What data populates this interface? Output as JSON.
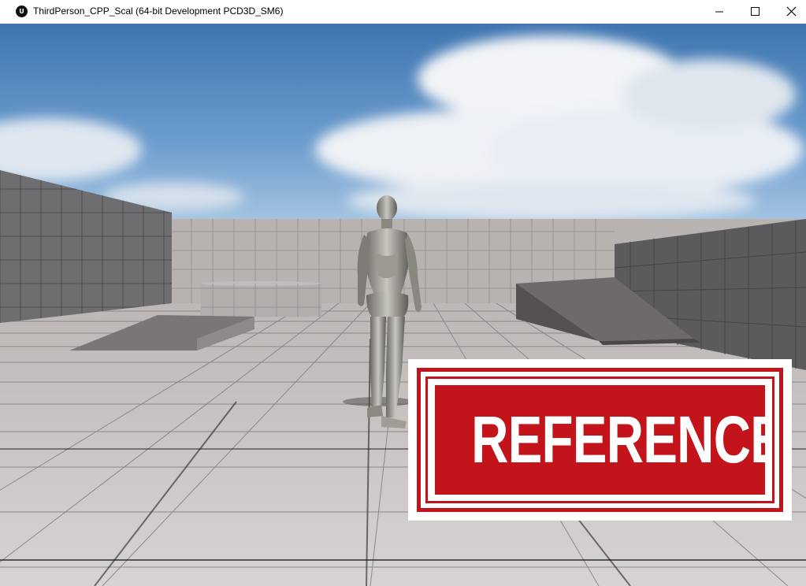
{
  "window": {
    "title": "ThirdPerson_CPP_Scal (64-bit Development PCD3D_SM6)",
    "app_icon": "unreal-engine-logo-icon",
    "app_icon_glyph": "U",
    "controls": [
      "minimize-icon",
      "maximize-icon",
      "close-icon"
    ]
  },
  "scene": {
    "description_icon": "third-person-viewport",
    "character": "mannequin-character",
    "sky_color": "#4a7fb8",
    "floor_color": "#c9c5c4"
  },
  "overlay": {
    "stamp_text": "REFERENCE",
    "stamp_color": "#c4141b"
  }
}
